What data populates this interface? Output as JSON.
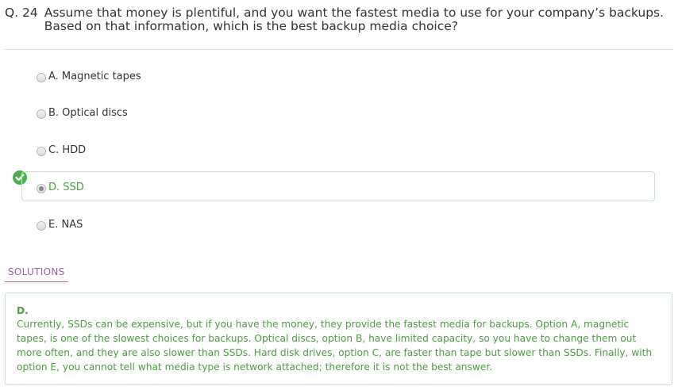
{
  "question": {
    "number": "Q. 24",
    "text": "Assume that money is plentiful, and you want the fastest media to use for your company’s backups. Based on that information, which is the best backup media choice?"
  },
  "options": [
    {
      "label": "A. Magnetic tapes",
      "selected": false,
      "correct": false
    },
    {
      "label": "B. Optical discs",
      "selected": false,
      "correct": false
    },
    {
      "label": "C. HDD",
      "selected": false,
      "correct": false
    },
    {
      "label": "D. SSD",
      "selected": true,
      "correct": true
    },
    {
      "label": "E. NAS",
      "selected": false,
      "correct": false
    }
  ],
  "solutions": {
    "tab_label": "SOLUTIONS",
    "answer": "D.",
    "explanation": "Currently, SSDs can be expensive, but if you have the money, they provide the fastest media for backups. Option A, magnetic tapes, is one of the slowest choices for backups. Optical discs, option B, have limited capacity, so you have to change them out more often, and they are also slower than SSDs. Hard disk drives, option C, are faster than tape but slower than SSDs. Finally, with option E, you cannot tell what media type is network attached; therefore it is not the best answer."
  },
  "colors": {
    "correct_green": "#4a9e3f",
    "badge_green": "#4caf50",
    "solutions_accent": "#9c5dab"
  },
  "icons": {
    "correct_marker": "check-circle-icon"
  }
}
